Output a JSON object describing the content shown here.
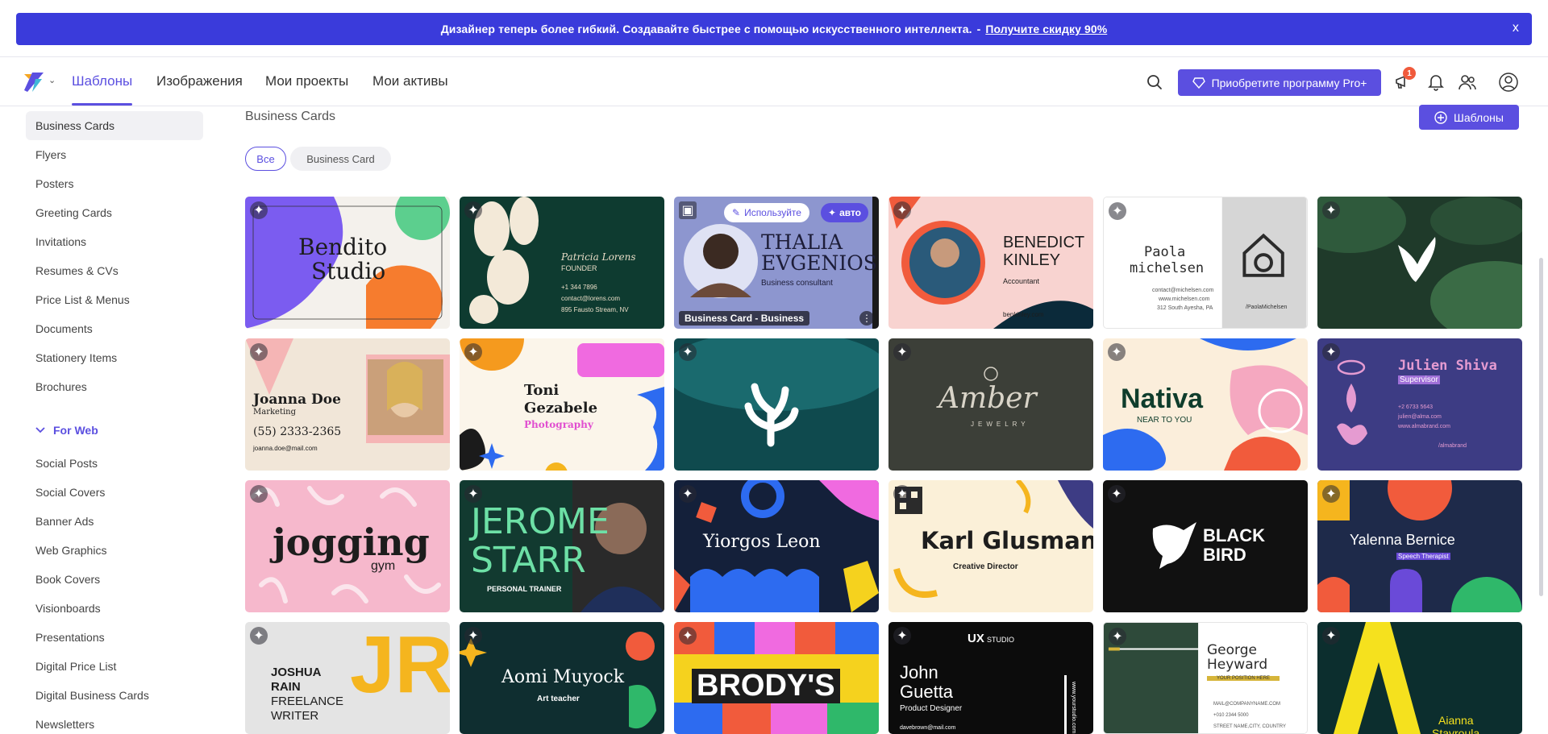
{
  "promo": {
    "text": "Дизайнер теперь более гибкий. Создавайте быстрее с помощью искусственного интеллекта.",
    "sep": "-",
    "link": "Получите скидку 90%",
    "close": "x"
  },
  "nav": {
    "tabs": [
      "Шаблоны",
      "Изображения",
      "Мои проекты",
      "Мои активы"
    ],
    "pro_button": "Приобретите программу Pro+",
    "notif_count": "1"
  },
  "sidebar": {
    "print_items": [
      "Business Cards",
      "Flyers",
      "Posters",
      "Greeting Cards",
      "Invitations",
      "Resumes & CVs",
      "Price List & Menus",
      "Documents",
      "Stationery Items",
      "Brochures"
    ],
    "group_label": "For Web",
    "web_items": [
      "Social Posts",
      "Social Covers",
      "Banner Ads",
      "Web Graphics",
      "Book Covers",
      "Visionboards",
      "Presentations",
      "Digital Price List",
      "Digital Business Cards",
      "Newsletters"
    ]
  },
  "main": {
    "title": "Business Cards",
    "templates_button": "Шаблоны",
    "filters": [
      "Все",
      "Business Card"
    ]
  },
  "hover_card": {
    "use_label": "Используйте",
    "auto_label": "авто",
    "caption": "Business Card - Business"
  },
  "cards": {
    "bendito": {
      "line1": "Bendito",
      "line2": "Studio"
    },
    "patricia": {
      "name": "Patricia Lorens",
      "role": "FOUNDER",
      "phone": "+1 344 7896",
      "email": "contact@lorens.com",
      "addr": "895 Fausto Stream, NV"
    },
    "thalia": {
      "line1": "THALIA",
      "line2": "EVGENIOS",
      "role": "Business consultant"
    },
    "benedict": {
      "line1": "BENEDICT",
      "line2": "KINLEY",
      "role": "Accountant",
      "site": "benkinley.com"
    },
    "paola": {
      "line1": "Paola",
      "line2": "michelsen",
      "email": "contact@michelsen.com",
      "site": "www.michelsen.com",
      "addr": "312 South Ayesha, PA",
      "handle": "/PaolaMichelsen"
    },
    "joanna": {
      "name": "Joanna Doe",
      "role": "Marketing",
      "phone": "(55) 2333-2365",
      "email": "joanna.doe@mail.com"
    },
    "toni": {
      "line1": "Toni",
      "line2": "Gezabele",
      "role": "Photography"
    },
    "amber": {
      "name": "Amber",
      "sub": "JEWELRY"
    },
    "nativa": {
      "name": "Nativa",
      "sub": "NEAR TO YOU"
    },
    "julien": {
      "name": "Julien Shiva",
      "role": "Supervisor",
      "phone": "+2 6733 5643",
      "email": "julien@alma.com",
      "site": "www.almabrand.com",
      "handle": "/almabrand"
    },
    "jogging": {
      "name": "jogging",
      "sub": "gym"
    },
    "jerome": {
      "line1": "JEROME",
      "line2": "STARR",
      "role": "PERSONAL TRAINER"
    },
    "yiorgos": {
      "name": "Yiorgos Leon"
    },
    "karl": {
      "name": "Karl Glusman",
      "role": "Creative Director"
    },
    "blackbird": {
      "line1": "BLACK",
      "line2": "BIRD"
    },
    "yalenna": {
      "name": "Yalenna Bernice",
      "role": "Speech Therapist"
    },
    "joshua": {
      "line1": "JOSHUA",
      "line2": "RAIN",
      "line3": "FREELANCE",
      "line4": "WRITER",
      "mono": "JR"
    },
    "aomi": {
      "name": "Aomi Muyock",
      "role": "Art teacher"
    },
    "brodys": {
      "name": "BRODY'S"
    },
    "john": {
      "studio": "UX",
      "studio2": "STUDIO",
      "line1": "John",
      "line2": "Guetta",
      "role": "Product Designer",
      "email": "davebrown@mail.com",
      "site": "www.yourstudio.com"
    },
    "george": {
      "line1": "George",
      "line2": "Heyward",
      "role": "YOUR POSITION HERE",
      "email": "MAIL@COMPANYNAME.COM",
      "phone": "+010 2344 5000",
      "addr": "STREET NAME,CITY, COUNTRY"
    },
    "aianna": {
      "mono": "A",
      "line1": "Aianna",
      "line2": "Stavroula"
    }
  },
  "colors": {
    "accent": "#5b4fe0",
    "promo_bg": "#3a3bdb"
  }
}
